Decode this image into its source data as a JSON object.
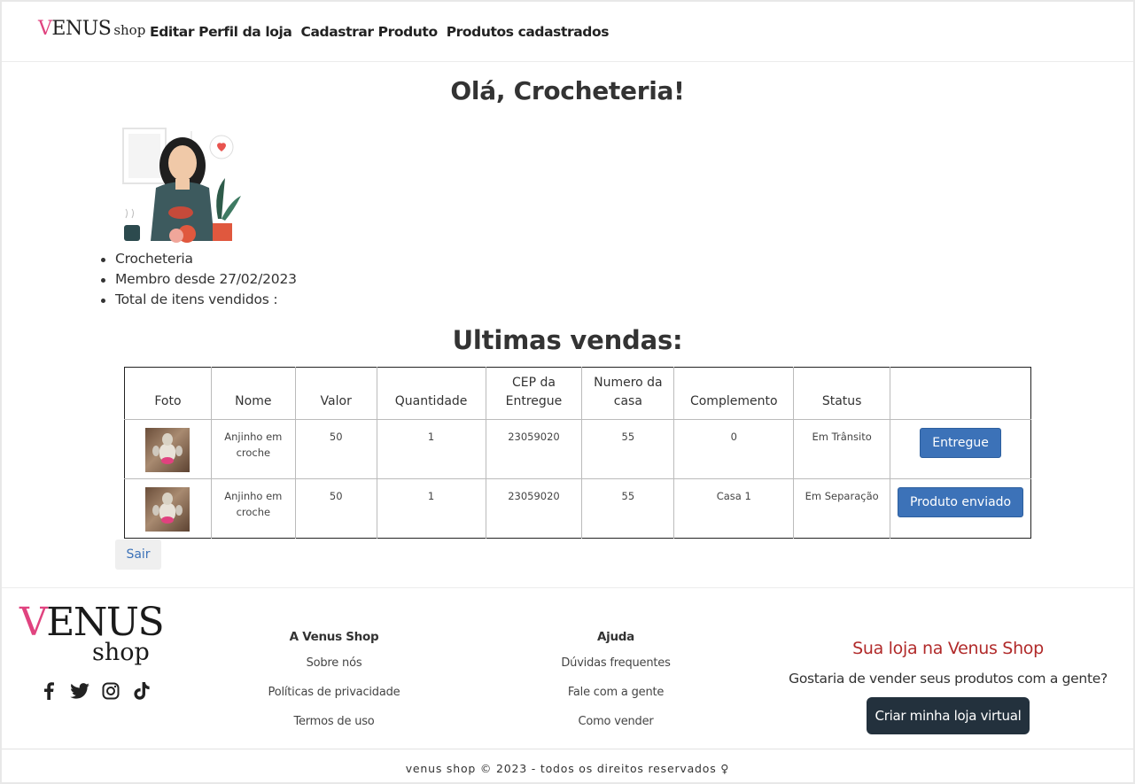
{
  "navbar": {
    "brand_main": "VENUS",
    "brand_v": "V",
    "brand_rest": "ENUS",
    "brand_sub": "shop",
    "links": [
      "Editar Perfil da loja",
      "Cadastrar Produto",
      "Produtos cadastrados"
    ]
  },
  "main": {
    "greeting": "Olá, Crocheteria!",
    "info": [
      "Crocheteria",
      "Membro desde 27/02/2023",
      "Total de itens vendidos :"
    ],
    "sales_title": "Ultimas vendas:",
    "table": {
      "headers": [
        "Foto",
        "Nome",
        "Valor",
        "Quantidade",
        "CEP da Entregue",
        "Numero da casa",
        "Complemento",
        "Status",
        ""
      ],
      "rows": [
        {
          "nome": "Anjinho em croche",
          "valor": "50",
          "quantidade": "1",
          "cep": "23059020",
          "numero": "55",
          "complemento": "0",
          "status": "Em Trânsito",
          "action": "Entregue"
        },
        {
          "nome": "Anjinho em croche",
          "valor": "50",
          "quantidade": "1",
          "cep": "23059020",
          "numero": "55",
          "complemento": "Casa 1",
          "status": "Em Separação",
          "action": "Produto enviado"
        }
      ]
    },
    "logout": "Sair"
  },
  "footer": {
    "logo_v": "V",
    "logo_rest": "ENUS",
    "logo_sub": "shop",
    "social": [
      "facebook-icon",
      "twitter-icon",
      "instagram-icon",
      "tiktok-icon"
    ],
    "col1": {
      "title": "A Venus Shop",
      "links": [
        "Sobre nós",
        "Políticas de privacidade",
        "Termos de uso"
      ]
    },
    "col2": {
      "title": "Ajuda",
      "links": [
        "Dúvidas frequentes",
        "Fale com a gente",
        "Como vender"
      ]
    },
    "cta": {
      "title": "Sua loja na Venus Shop",
      "text": "Gostaria de vender seus produtos com a gente?",
      "button": "Criar minha loja virtual"
    },
    "copyright": "venus shop © 2023 - todos os direitos reservados ♀"
  },
  "colors": {
    "accent_pink": "#e0437f",
    "button_blue": "#3c72b8",
    "cta_red": "#b12a2a",
    "dark_button": "#23313d"
  }
}
